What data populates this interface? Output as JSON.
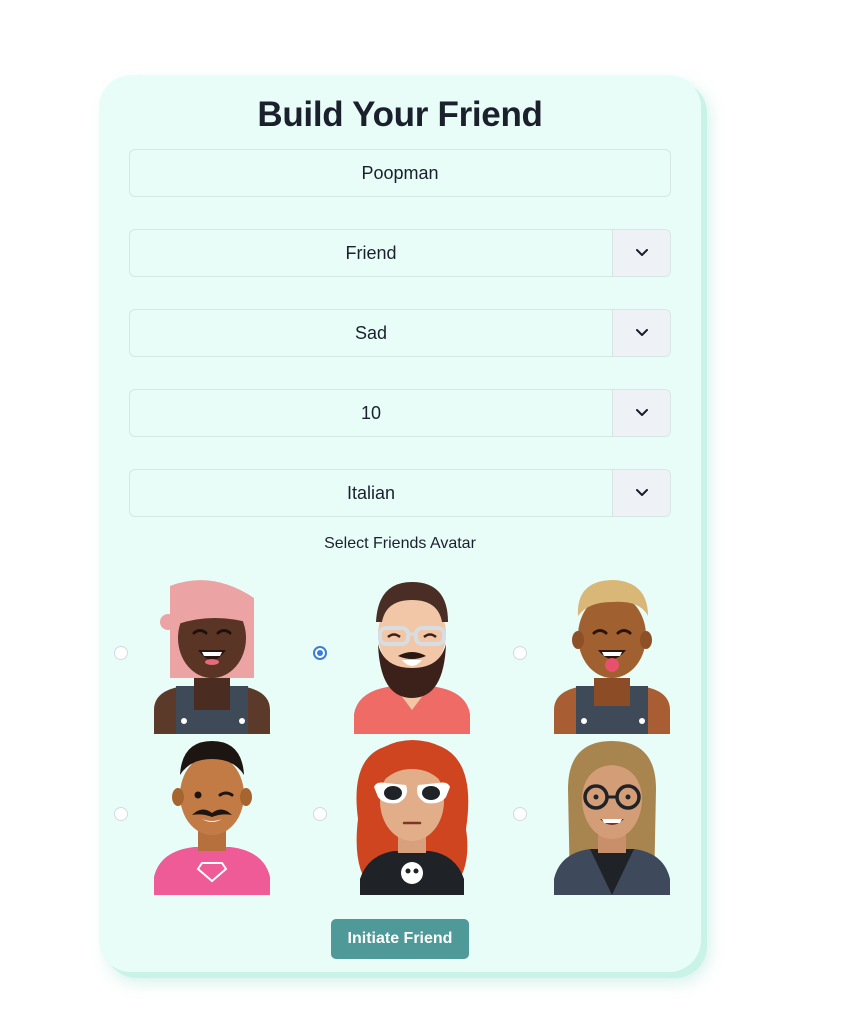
{
  "form": {
    "title": "Build Your Friend",
    "name_value": "Poopman",
    "relationship_value": "Friend",
    "mood_value": "Sad",
    "number_value": "10",
    "cuisine_value": "Italian",
    "avatar_label": "Select Friends Avatar",
    "submit_label": "Initiate Friend",
    "selected_avatar": 2
  },
  "icons": {
    "dropdown": "chevron-down-icon"
  },
  "colors": {
    "card_bg": "#e9fdf8",
    "button_bg": "#4f9998",
    "radio_selected": "#3b7dd8"
  }
}
